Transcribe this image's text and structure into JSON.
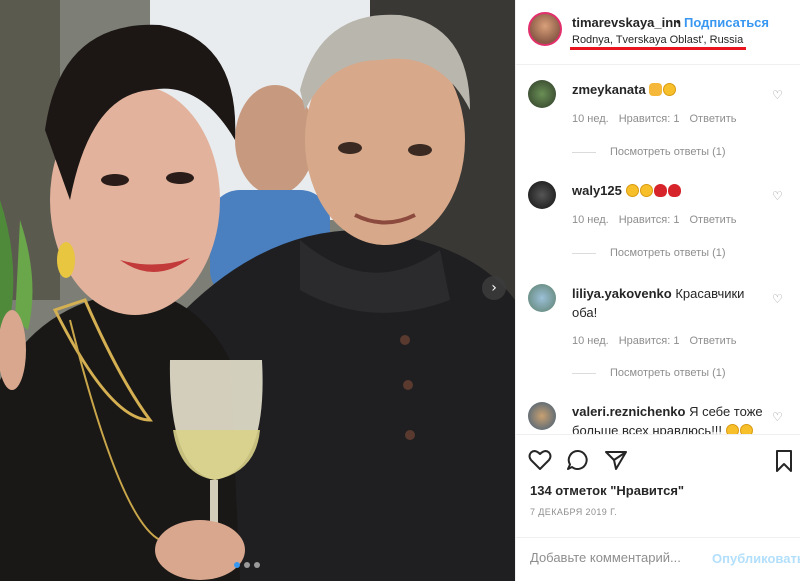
{
  "post": {
    "username": "timarevskaya_inn",
    "separator": "•",
    "follow_label": "Подписаться",
    "location": "Rodnya, Tverskaya Oblast', Russia"
  },
  "comments": [
    {
      "username": "zmeykanata",
      "text": "",
      "emojis": [
        "thumbs-up",
        "laughing-face"
      ],
      "time": "10 нед.",
      "likes": "Нравится: 1",
      "reply": "Ответить",
      "view_replies": "Посмотреть ответы (1)"
    },
    {
      "username": "waly125",
      "text": "",
      "emojis": [
        "heart-eyes-face",
        "heart-eyes-face",
        "rose",
        "rose"
      ],
      "time": "10 нед.",
      "likes": "Нравится: 1",
      "reply": "Ответить",
      "view_replies": "Посмотреть ответы (1)"
    },
    {
      "username": "liliya.yakovenko",
      "text": "Красавчики оба!",
      "emojis": [],
      "time": "10 нед.",
      "likes": "Нравится: 1",
      "reply": "Ответить",
      "view_replies": "Посмотреть ответы (1)"
    },
    {
      "username": "valeri.reznichenko",
      "text": "Я себе тоже больше всех нравлюсь!!!",
      "emojis": [
        "laughing-face",
        "laughing-face"
      ],
      "time": "",
      "likes": "",
      "reply": "",
      "view_replies": ""
    }
  ],
  "actions": {
    "likes_text": "134 отметок \"Нравится\"",
    "date": "7 ДЕКАБРЯ 2019 Г.",
    "comment_placeholder": "Добавьте комментарий...",
    "publish_label": "Опубликовать"
  },
  "carousel": {
    "total": 3,
    "active": 0
  },
  "colors": {
    "link_blue": "#3897f0",
    "publish_disabled": "#b2dffc",
    "underline_red": "#e8141e",
    "muted_text": "#8e8e8e"
  }
}
